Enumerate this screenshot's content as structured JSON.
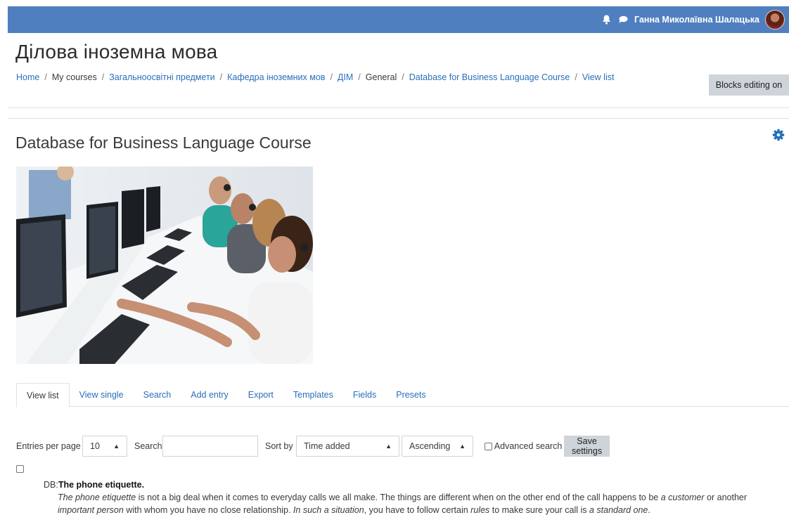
{
  "header": {
    "username": "Ганна Миколаївна Шалацька",
    "icons": [
      "bell-icon",
      "chat-icon"
    ],
    "bar_color": "#4f7fbf"
  },
  "course": {
    "title": "Ділова іноземна мова"
  },
  "breadcrumb": [
    {
      "label": "Home",
      "link": true
    },
    {
      "label": "My courses",
      "link": false
    },
    {
      "label": "Загальноосвітні предмети",
      "link": true
    },
    {
      "label": "Кафедра іноземних мов",
      "link": true
    },
    {
      "label": "ДІМ",
      "link": true
    },
    {
      "label": "General",
      "link": false
    },
    {
      "label": "Database for Business Language Course",
      "link": true
    },
    {
      "label": "View list",
      "link": true
    }
  ],
  "blocks_editing_label": "Blocks editing on",
  "database": {
    "title": "Database for Business Language Course"
  },
  "tabs": [
    {
      "label": "View list",
      "active": true
    },
    {
      "label": "View single",
      "active": false
    },
    {
      "label": "Search",
      "active": false
    },
    {
      "label": "Add entry",
      "active": false
    },
    {
      "label": "Export",
      "active": false
    },
    {
      "label": "Templates",
      "active": false
    },
    {
      "label": "Fields",
      "active": false
    },
    {
      "label": "Presets",
      "active": false
    }
  ],
  "controls": {
    "entries_per_page_label": "Entries per page",
    "entries_per_page_value": "10",
    "search_label": "Search",
    "search_value": "",
    "sort_by_label": "Sort by",
    "sort_by_value": "Time added",
    "order_value": "Ascending",
    "advanced_search_label": "Advanced search",
    "save_settings_label": "Save settings"
  },
  "entry": {
    "db_prefix": "DB:",
    "title": "The phone etiquette.",
    "segments": [
      {
        "t": "The phone etiquette",
        "i": true
      },
      {
        "t": " is not a big deal when it comes to everyday calls we all make. The things are different when on the other end of the call happens to be ",
        "i": false
      },
      {
        "t": "a customer",
        "i": true
      },
      {
        "t": " or another ",
        "i": false
      },
      {
        "t": "important person",
        "i": true
      },
      {
        "t": " with whom you have no close relationship. ",
        "i": false
      },
      {
        "t": "In such a situation",
        "i": true
      },
      {
        "t": ", you have to follow certain ",
        "i": false
      },
      {
        "t": "rules",
        "i": true
      },
      {
        "t": " to make sure your call is ",
        "i": false
      },
      {
        "t": "a standard one",
        "i": true
      },
      {
        "t": ".",
        "i": false
      }
    ]
  },
  "colors": {
    "link": "#2a6ebb",
    "gear": "#1f6fb7",
    "button_gray": "#ced4da"
  }
}
